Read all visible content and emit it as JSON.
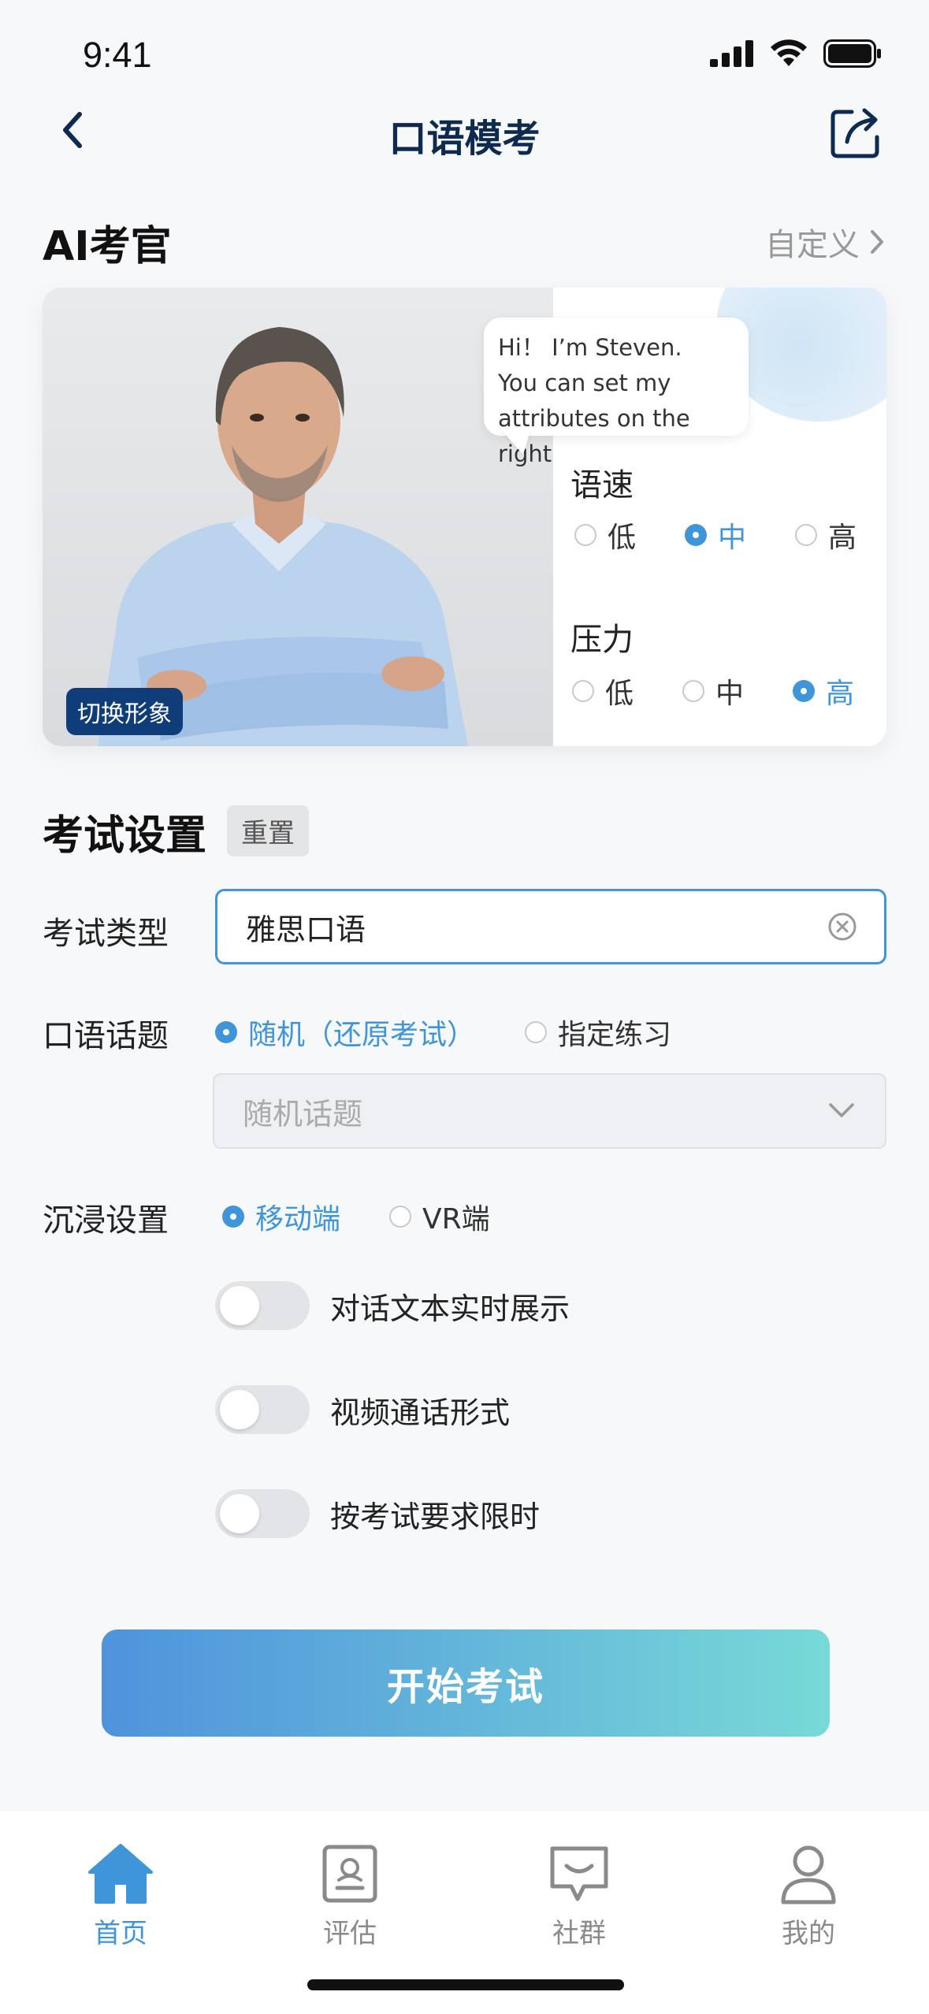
{
  "status_bar": {
    "time": "9:41"
  },
  "header": {
    "title": "口语模考"
  },
  "ai_examiner": {
    "title": "AI考官",
    "custom_link": "自定义",
    "switch_avatar": "切换形象",
    "bubble_lines": [
      "Hi！ I’m Steven.",
      "You can set my",
      "attributes on the right"
    ],
    "speed": {
      "label": "语速",
      "options": [
        "低",
        "中",
        "高"
      ],
      "selected": "中"
    },
    "pressure": {
      "label": "压力",
      "options": [
        "低",
        "中",
        "高"
      ],
      "selected": "高"
    }
  },
  "exam_settings": {
    "title": "考试设置",
    "reset": "重置",
    "exam_type": {
      "label": "考试类型",
      "value": "雅思口语"
    },
    "topic": {
      "label": "口语话题",
      "options": [
        "随机（还原考试）",
        "指定练习"
      ],
      "selected": "随机（还原考试）",
      "select_placeholder": "随机话题"
    },
    "immersion": {
      "label": "沉浸设置",
      "options": [
        "移动端",
        "VR端"
      ],
      "selected": "移动端"
    },
    "toggles": [
      {
        "label": "对话文本实时展示",
        "on": false
      },
      {
        "label": "视频通话形式",
        "on": false
      },
      {
        "label": "按考试要求限时",
        "on": false
      }
    ]
  },
  "start_button": "开始考试",
  "tabbar": {
    "items": [
      {
        "label": "首页",
        "icon": "home-icon",
        "active": true
      },
      {
        "label": "评估",
        "icon": "assessment-icon",
        "active": false
      },
      {
        "label": "社群",
        "icon": "chat-icon",
        "active": false
      },
      {
        "label": "我的",
        "icon": "profile-icon",
        "active": false
      }
    ]
  },
  "colors": {
    "accent": "#3f95d9",
    "title": "#0e2a4e",
    "badge": "#0f3d7a"
  }
}
